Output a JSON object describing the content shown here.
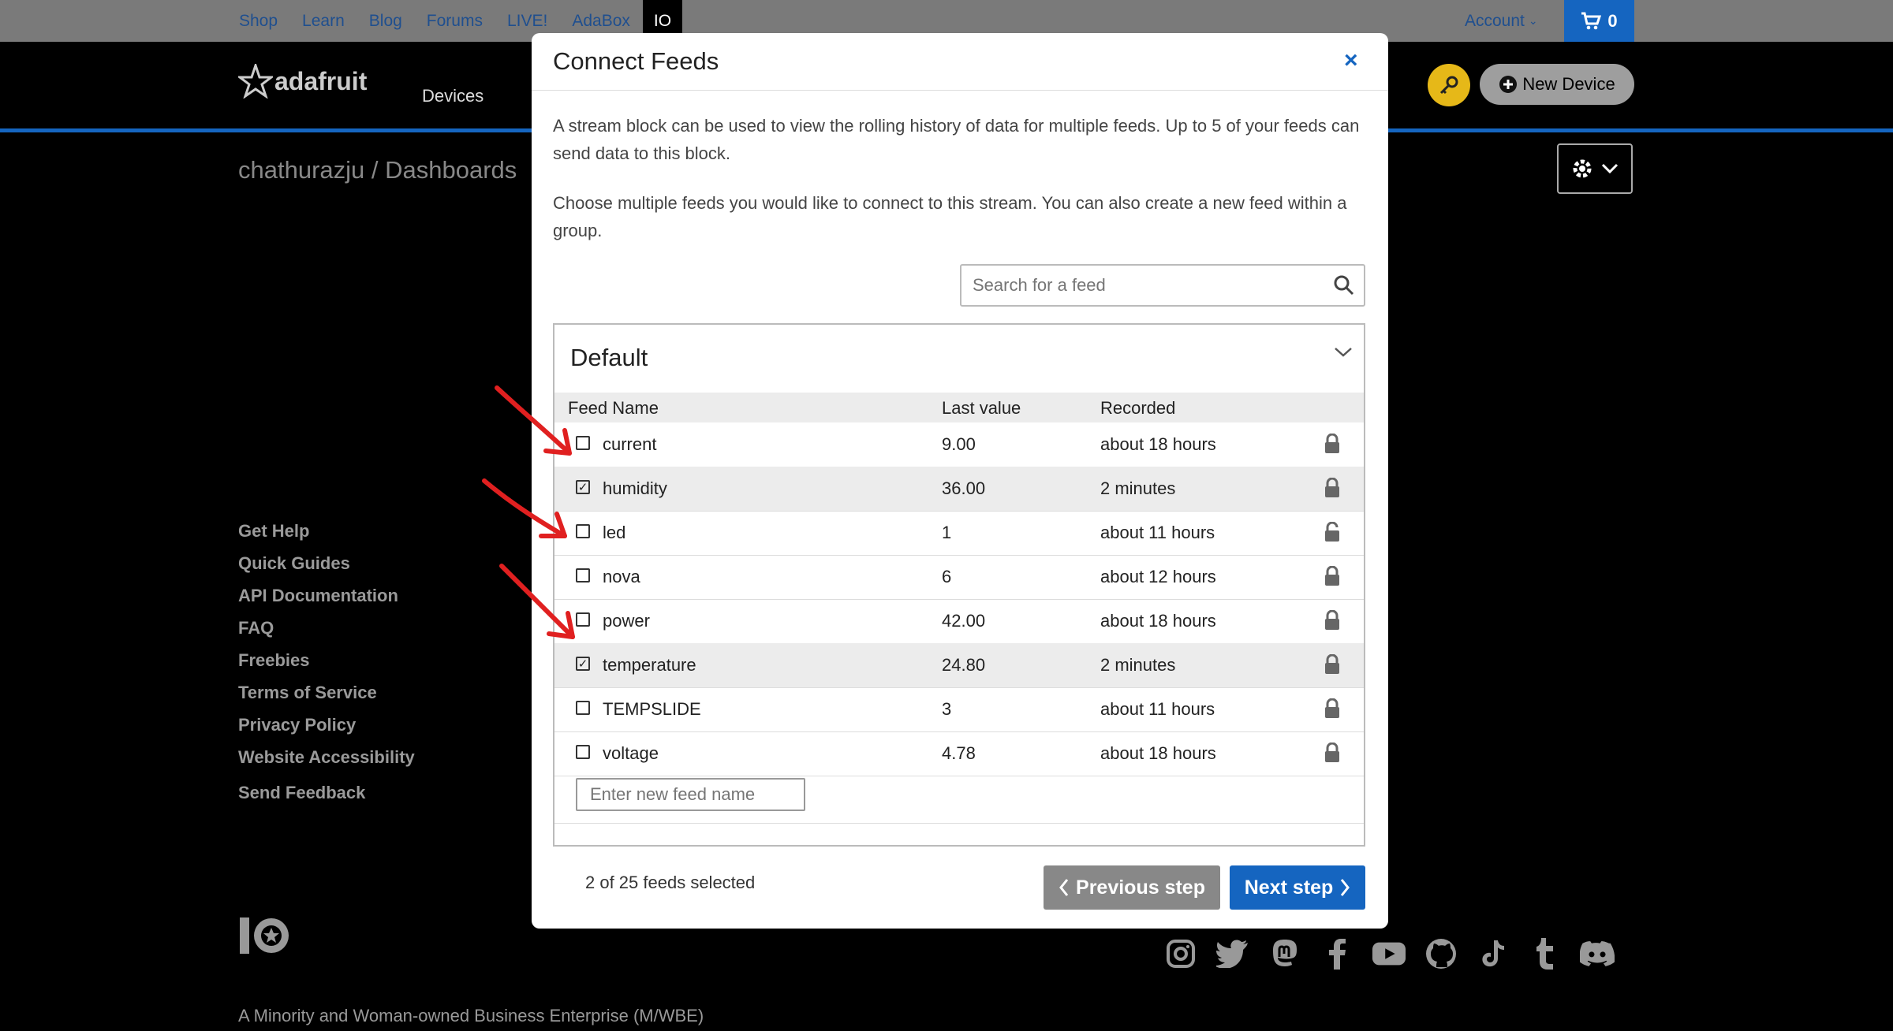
{
  "topbar": {
    "links": [
      "Shop",
      "Learn",
      "Blog",
      "Forums",
      "LIVE!",
      "AdaBox"
    ],
    "io_tab": "IO",
    "account": "Account",
    "cart_count": "0"
  },
  "header": {
    "logo": "adafruit",
    "nav_devices": "Devices",
    "new_device": "New Device"
  },
  "page": {
    "breadcrumb": "chathurazju / Dashboards"
  },
  "footer": {
    "links": [
      "Get Help",
      "Quick Guides",
      "API Documentation",
      "FAQ",
      "Freebies",
      "Terms of Service",
      "Privacy Policy",
      "Website Accessibility",
      "Send Feedback"
    ],
    "mwbe": "A Minority and Woman-owned Business Enterprise (M/WBE)",
    "socials": [
      "instagram-icon",
      "twitter-icon",
      "mastodon-icon",
      "facebook-icon",
      "youtube-icon",
      "github-icon",
      "tiktok-icon",
      "tumblr-icon",
      "discord-icon"
    ]
  },
  "modal": {
    "title": "Connect Feeds",
    "close": "×",
    "intro": "A stream block can be used to view the rolling history of data for multiple feeds. Up to 5 of your feeds can send data to this block.",
    "choose": "Choose multiple feeds you would like to connect to this stream. You can also create a new feed within a group.",
    "search_placeholder": "Search for a feed",
    "group": "Default",
    "columns": {
      "name": "Feed Name",
      "value": "Last value",
      "recorded": "Recorded"
    },
    "feeds": [
      {
        "name": "current",
        "value": "9.00",
        "recorded": "about 18 hours",
        "checked": false,
        "locked": true
      },
      {
        "name": "humidity",
        "value": "36.00",
        "recorded": "2 minutes",
        "checked": true,
        "locked": true
      },
      {
        "name": "led",
        "value": "1",
        "recorded": "about 11 hours",
        "checked": false,
        "locked": false
      },
      {
        "name": "nova",
        "value": "6",
        "recorded": "about 12 hours",
        "checked": false,
        "locked": true
      },
      {
        "name": "power",
        "value": "42.00",
        "recorded": "about 18 hours",
        "checked": false,
        "locked": true
      },
      {
        "name": "temperature",
        "value": "24.80",
        "recorded": "2 minutes",
        "checked": true,
        "locked": true
      },
      {
        "name": "TEMPSLIDE",
        "value": "3",
        "recorded": "about 11 hours",
        "checked": false,
        "locked": true
      },
      {
        "name": "voltage",
        "value": "4.78",
        "recorded": "about 18 hours",
        "checked": false,
        "locked": true
      }
    ],
    "new_feed_placeholder": "Enter new feed name",
    "selected_count": "2 of 25 feeds selected",
    "prev_label": "Previous step",
    "next_label": "Next step"
  },
  "colors": {
    "accent": "#1565c0",
    "annotation": "#e02020",
    "key": "#e6b818"
  }
}
